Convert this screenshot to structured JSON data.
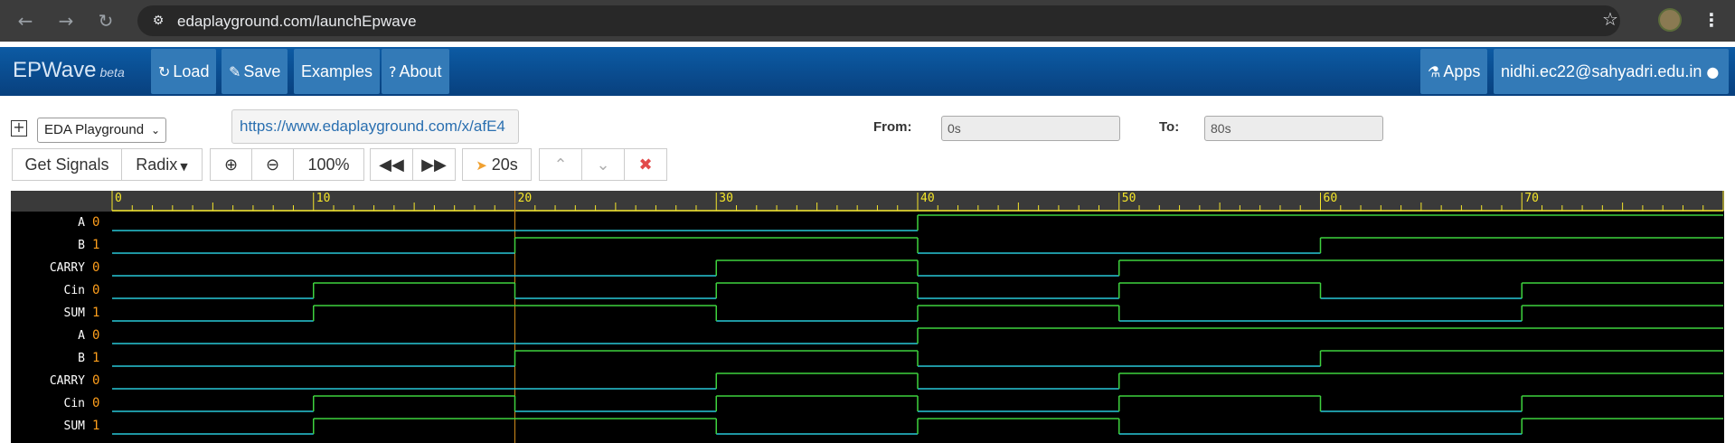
{
  "browser": {
    "back_icon": "arrow-left-icon",
    "forward_icon": "arrow-right-icon",
    "reload_icon": "reload-icon",
    "url_host": "edaplayground.com",
    "url_path": "/launchEpwave"
  },
  "navbar": {
    "brand": "EPWave",
    "brand_sub": "beta",
    "load": "Load",
    "save": "Save",
    "examples": "Examples",
    "about": "About",
    "apps": "Apps",
    "user": "nidhi.ec22@sahyadri.edu.in"
  },
  "toolbar": {
    "source_select": "EDA Playground",
    "share_url": "https://www.edaplayground.com/x/afE4",
    "from_label": "From:",
    "from_value": "0s",
    "to_label": "To:",
    "to_value": "80s",
    "get_signals": "Get Signals",
    "radix": "Radix",
    "zoom_level": "100%",
    "step": "20s"
  },
  "waveform": {
    "time_range": [
      0,
      80
    ],
    "tick_labels": [
      "0",
      "10",
      "20",
      "30",
      "40",
      "50",
      "60",
      "70"
    ],
    "cursor_time": 20,
    "colors": {
      "high": "#3ed23e",
      "low": "#28c8d8",
      "value": "#ff9f1c",
      "ruler_text": "#f5e62a",
      "cursor": "#d08b1a"
    },
    "signals": [
      {
        "name": "A",
        "value": "0",
        "transitions": [
          [
            0,
            0
          ],
          [
            40,
            1
          ]
        ]
      },
      {
        "name": "B",
        "value": "1",
        "transitions": [
          [
            0,
            0
          ],
          [
            20,
            1
          ],
          [
            40,
            0
          ],
          [
            60,
            1
          ]
        ]
      },
      {
        "name": "CARRY",
        "value": "0",
        "transitions": [
          [
            0,
            0
          ],
          [
            30,
            1
          ],
          [
            40,
            0
          ],
          [
            50,
            1
          ]
        ]
      },
      {
        "name": "Cin",
        "value": "0",
        "transitions": [
          [
            0,
            0
          ],
          [
            10,
            1
          ],
          [
            20,
            0
          ],
          [
            30,
            1
          ],
          [
            40,
            0
          ],
          [
            50,
            1
          ],
          [
            60,
            0
          ],
          [
            70,
            1
          ]
        ]
      },
      {
        "name": "SUM",
        "value": "1",
        "transitions": [
          [
            0,
            0
          ],
          [
            10,
            1
          ],
          [
            20,
            1
          ],
          [
            30,
            0
          ],
          [
            40,
            1
          ],
          [
            50,
            0
          ],
          [
            60,
            0
          ],
          [
            70,
            1
          ]
        ]
      },
      {
        "name": "A",
        "value": "0",
        "transitions": [
          [
            0,
            0
          ],
          [
            40,
            1
          ]
        ]
      },
      {
        "name": "B",
        "value": "1",
        "transitions": [
          [
            0,
            0
          ],
          [
            20,
            1
          ],
          [
            40,
            0
          ],
          [
            60,
            1
          ]
        ]
      },
      {
        "name": "CARRY",
        "value": "0",
        "transitions": [
          [
            0,
            0
          ],
          [
            30,
            1
          ],
          [
            40,
            0
          ],
          [
            50,
            1
          ]
        ]
      },
      {
        "name": "Cin",
        "value": "0",
        "transitions": [
          [
            0,
            0
          ],
          [
            10,
            1
          ],
          [
            20,
            0
          ],
          [
            30,
            1
          ],
          [
            40,
            0
          ],
          [
            50,
            1
          ],
          [
            60,
            0
          ],
          [
            70,
            1
          ]
        ]
      },
      {
        "name": "SUM",
        "value": "1",
        "transitions": [
          [
            0,
            0
          ],
          [
            10,
            1
          ],
          [
            20,
            1
          ],
          [
            30,
            0
          ],
          [
            40,
            1
          ],
          [
            50,
            0
          ],
          [
            60,
            0
          ],
          [
            70,
            1
          ]
        ]
      }
    ]
  }
}
